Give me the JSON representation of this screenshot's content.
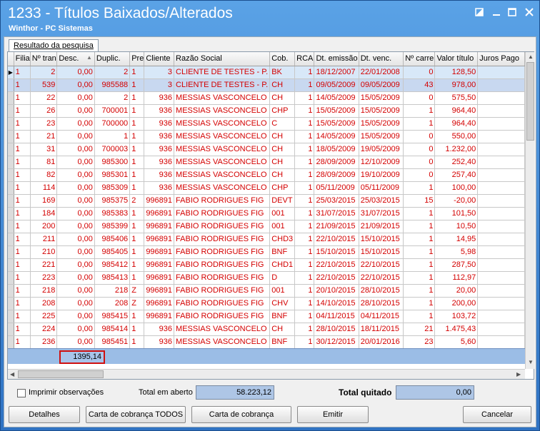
{
  "window": {
    "title": "1233 - Títulos Baixados/Alterados",
    "subtitle": "Winthor - PC Sistemas"
  },
  "tab": {
    "label": "Resultado da pesquisa"
  },
  "columns": [
    "Filia",
    "Nº tran",
    "Desc.",
    "Duplic.",
    "Pre",
    "Cliente",
    "Razão Social",
    "Cob.",
    "RCA",
    "Dt. emissão",
    "Dt. venc.",
    "Nº carre",
    "Valor título",
    "Juros Pago"
  ],
  "rows": [
    [
      "1",
      "2",
      "0,00",
      "2",
      "1",
      "3",
      "CLIENTE DE TESTES - P.",
      "BK",
      "1",
      "18/12/2007",
      "22/01/2008",
      "0",
      "128,50",
      ""
    ],
    [
      "1",
      "539",
      "0,00",
      "985588",
      "1",
      "3",
      "CLIENTE DE TESTES - P.",
      "CH",
      "1",
      "09/05/2009",
      "09/05/2009",
      "43",
      "978,00",
      ""
    ],
    [
      "1",
      "22",
      "0,00",
      "2",
      "1",
      "936",
      "MESSIAS VASCONCELO",
      "CH",
      "1",
      "14/05/2009",
      "15/05/2009",
      "0",
      "575,50",
      ""
    ],
    [
      "1",
      "26",
      "0,00",
      "700001",
      "1",
      "936",
      "MESSIAS VASCONCELO",
      "CHP",
      "1",
      "15/05/2009",
      "15/05/2009",
      "1",
      "964,40",
      ""
    ],
    [
      "1",
      "23",
      "0,00",
      "700000",
      "1",
      "936",
      "MESSIAS VASCONCELO",
      "C",
      "1",
      "15/05/2009",
      "15/05/2009",
      "1",
      "964,40",
      ""
    ],
    [
      "1",
      "21",
      "0,00",
      "1",
      "1",
      "936",
      "MESSIAS VASCONCELO",
      "CH",
      "1",
      "14/05/2009",
      "15/05/2009",
      "0",
      "550,00",
      ""
    ],
    [
      "1",
      "31",
      "0,00",
      "700003",
      "1",
      "936",
      "MESSIAS VASCONCELO",
      "CH",
      "1",
      "18/05/2009",
      "19/05/2009",
      "0",
      "1.232,00",
      ""
    ],
    [
      "1",
      "81",
      "0,00",
      "985300",
      "1",
      "936",
      "MESSIAS VASCONCELO",
      "CH",
      "1",
      "28/09/2009",
      "12/10/2009",
      "0",
      "252,40",
      ""
    ],
    [
      "1",
      "82",
      "0,00",
      "985301",
      "1",
      "936",
      "MESSIAS VASCONCELO",
      "CH",
      "1",
      "28/09/2009",
      "19/10/2009",
      "0",
      "257,40",
      ""
    ],
    [
      "1",
      "114",
      "0,00",
      "985309",
      "1",
      "936",
      "MESSIAS VASCONCELO",
      "CHP",
      "1",
      "05/11/2009",
      "05/11/2009",
      "1",
      "100,00",
      ""
    ],
    [
      "1",
      "169",
      "0,00",
      "985375",
      "2",
      "996891",
      "FABIO RODRIGUES FIG",
      "DEVT",
      "1",
      "25/03/2015",
      "25/03/2015",
      "15",
      "-20,00",
      ""
    ],
    [
      "1",
      "184",
      "0,00",
      "985383",
      "1",
      "996891",
      "FABIO RODRIGUES FIG",
      "001",
      "1",
      "31/07/2015",
      "31/07/2015",
      "1",
      "101,50",
      ""
    ],
    [
      "1",
      "200",
      "0,00",
      "985399",
      "1",
      "996891",
      "FABIO RODRIGUES FIG",
      "001",
      "1",
      "21/09/2015",
      "21/09/2015",
      "1",
      "10,50",
      ""
    ],
    [
      "1",
      "211",
      "0,00",
      "985406",
      "1",
      "996891",
      "FABIO RODRIGUES FIG",
      "CHD3",
      "1",
      "22/10/2015",
      "15/10/2015",
      "1",
      "14,95",
      ""
    ],
    [
      "1",
      "210",
      "0,00",
      "985405",
      "1",
      "996891",
      "FABIO RODRIGUES FIG",
      "BNF",
      "1",
      "15/10/2015",
      "15/10/2015",
      "1",
      "5,98",
      ""
    ],
    [
      "1",
      "221",
      "0,00",
      "985412",
      "1",
      "996891",
      "FABIO RODRIGUES FIG",
      "CHD1",
      "1",
      "22/10/2015",
      "22/10/2015",
      "1",
      "287,50",
      ""
    ],
    [
      "1",
      "223",
      "0,00",
      "985413",
      "1",
      "996891",
      "FABIO RODRIGUES FIG",
      "D",
      "1",
      "22/10/2015",
      "22/10/2015",
      "1",
      "112,97",
      ""
    ],
    [
      "1",
      "218",
      "0,00",
      "218",
      "Z",
      "996891",
      "FABIO RODRIGUES FIG",
      "001",
      "1",
      "20/10/2015",
      "28/10/2015",
      "1",
      "20,00",
      ""
    ],
    [
      "1",
      "208",
      "0,00",
      "208",
      "Z",
      "996891",
      "FABIO RODRIGUES FIG",
      "CHV",
      "1",
      "14/10/2015",
      "28/10/2015",
      "1",
      "200,00",
      ""
    ],
    [
      "1",
      "225",
      "0,00",
      "985415",
      "1",
      "996891",
      "FABIO RODRIGUES FIG",
      "BNF",
      "1",
      "04/11/2015",
      "04/11/2015",
      "1",
      "103,72",
      ""
    ],
    [
      "1",
      "224",
      "0,00",
      "985414",
      "1",
      "936",
      "MESSIAS VASCONCELO",
      "CH",
      "1",
      "28/10/2015",
      "18/11/2015",
      "21",
      "1.475,43",
      ""
    ],
    [
      "1",
      "236",
      "0,00",
      "985451",
      "1",
      "936",
      "MESSIAS VASCONCELO",
      "BNF",
      "1",
      "30/12/2015",
      "20/01/2016",
      "23",
      "5,60",
      ""
    ]
  ],
  "footer": {
    "sum_desc": "1395,14"
  },
  "bottom": {
    "print_obs_label": "Imprimir observações",
    "total_aberto_label": "Total em aberto",
    "total_aberto_value": "58.223,12",
    "total_quitado_label": "Total quitado",
    "total_quitado_value": "0,00"
  },
  "buttons": {
    "detalhes": "Detalhes",
    "carta_todos": "Carta de cobrança TODOS",
    "carta": "Carta de cobrança",
    "emitir": "Emitir",
    "cancelar": "Cancelar"
  }
}
